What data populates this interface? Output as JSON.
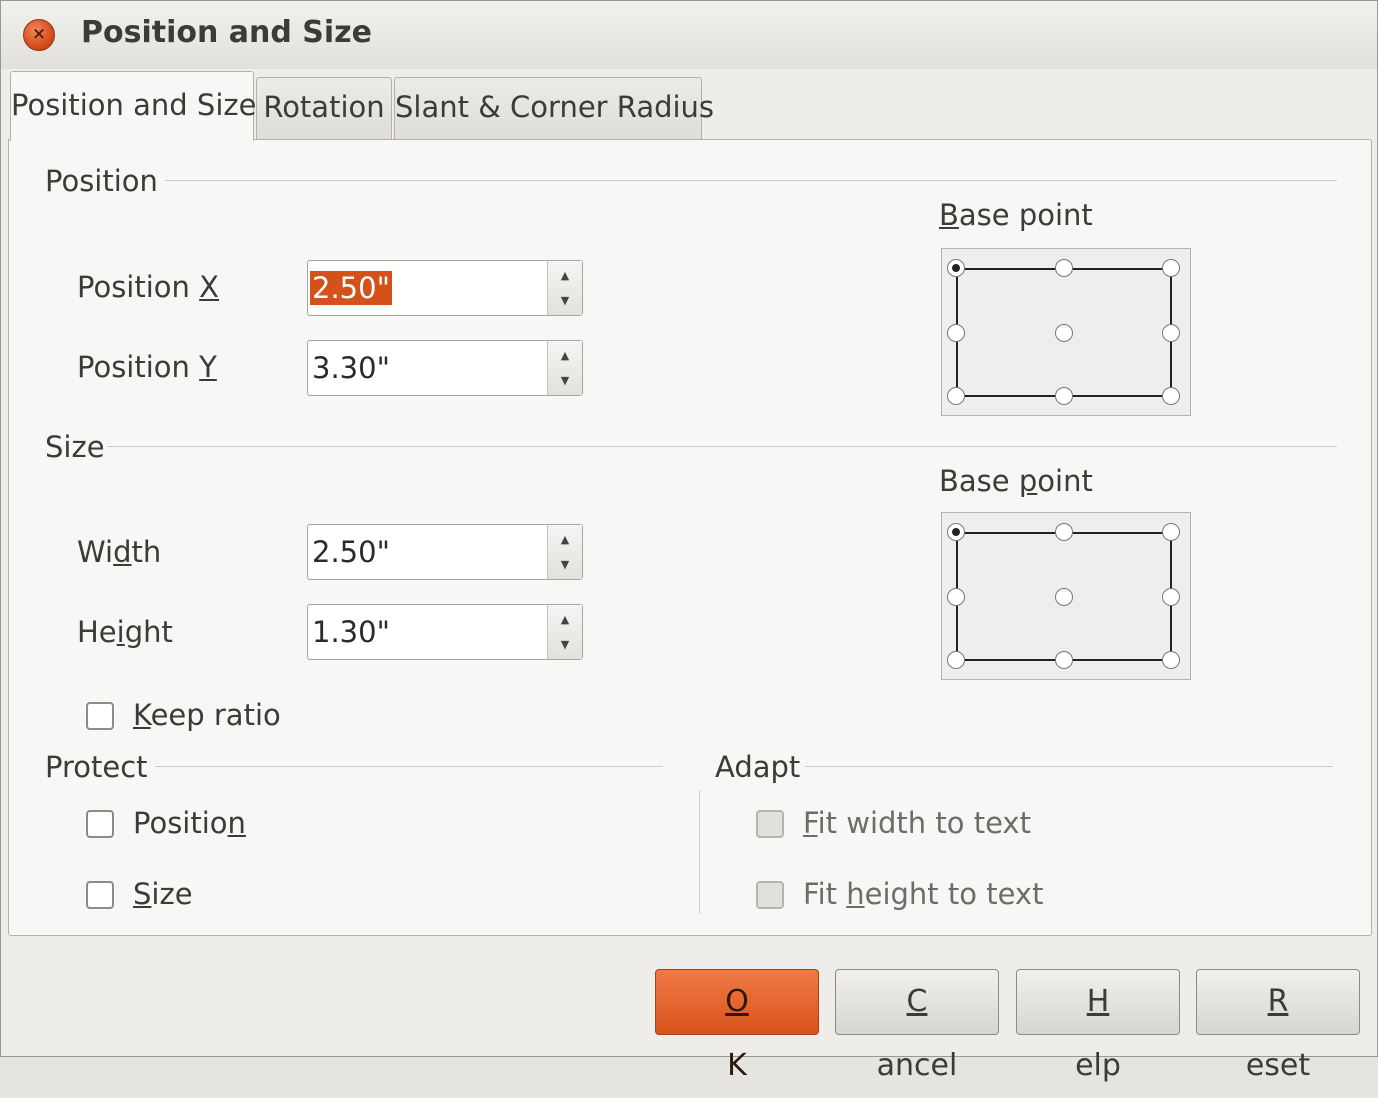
{
  "window": {
    "title": "Position and Size",
    "close_glyph": "×"
  },
  "tabs": [
    {
      "label": "Position and Size",
      "active": true
    },
    {
      "label": "Rotation",
      "active": false
    },
    {
      "label": "Slant & Corner Radius",
      "active": false
    }
  ],
  "position": {
    "heading": "Position",
    "x": {
      "label_pre": "Position ",
      "label_key": "X",
      "value": "2.50\""
    },
    "y": {
      "label_pre": "Position ",
      "label_key": "Y",
      "value": "3.30\""
    },
    "base_point": {
      "label_key": "B",
      "label_rest": "ase point",
      "selected": "top-left"
    }
  },
  "size": {
    "heading": "Size",
    "width": {
      "label_pre": "Wi",
      "label_key": "d",
      "label_post": "th",
      "value": "2.50\""
    },
    "height": {
      "label_pre": "He",
      "label_key": "i",
      "label_post": "ght",
      "value": "1.30\""
    },
    "keep_ratio": {
      "label_key": "K",
      "label_rest": "eep ratio",
      "checked": false
    },
    "base_point": {
      "label_pre": "Base ",
      "label_key": "p",
      "label_rest": "oint",
      "selected": "top-left"
    }
  },
  "protect": {
    "heading": "Protect",
    "position": {
      "label_pre": "Positio",
      "label_key": "n",
      "checked": false
    },
    "size": {
      "label_key": "S",
      "label_rest": "ize",
      "checked": false
    }
  },
  "adapt": {
    "heading": "Adapt",
    "fit_width": {
      "label_key": "F",
      "label_rest": "it width to text",
      "enabled": false
    },
    "fit_height": {
      "label_pre": "Fit ",
      "label_key": "h",
      "label_rest": "eight to text",
      "enabled": false
    }
  },
  "buttons": {
    "ok": {
      "key": "O",
      "rest": "K"
    },
    "cancel": {
      "key": "C",
      "rest": "ancel"
    },
    "help": {
      "key": "H",
      "rest": "elp"
    },
    "reset": {
      "key": "R",
      "rest": "eset"
    }
  },
  "colors": {
    "accent": "#dd5a22",
    "selection": "#d4521a"
  }
}
